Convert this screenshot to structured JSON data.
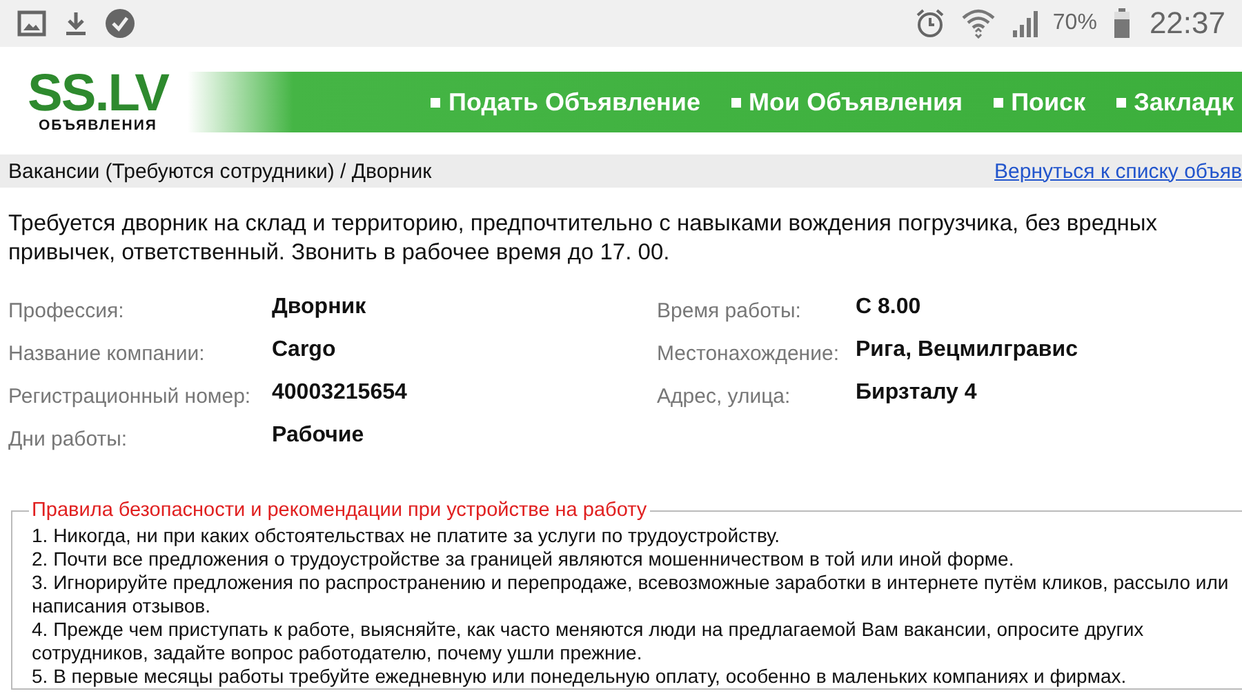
{
  "status_bar": {
    "battery": "70%",
    "time": "22:37"
  },
  "header": {
    "logo": "SS.LV",
    "logo_subtitle": "ОБЪЯВЛЕНИЯ",
    "menu": [
      {
        "label": "Подать Объявление"
      },
      {
        "label": "Мои Объявления"
      },
      {
        "label": "Поиск"
      },
      {
        "label": "Закладк"
      }
    ]
  },
  "breadcrumb": {
    "path": "Вакансии (Требуются сотрудники) / Дворник",
    "back_link": "Вернуться к списку объяв"
  },
  "description": "Требуется дворник на склад и территорию, предпочтительно с навыками вождения погрузчика, без вредных привычек, ответственный. Звонить в рабочее время до 17. 00.",
  "details": [
    [
      {
        "label": "Профессия:",
        "value": "Дворник"
      },
      {
        "label": "Название компании:",
        "value": "Cargo"
      },
      {
        "label": "Регистрационный номер:",
        "value": "40003215654"
      },
      {
        "label": "Дни работы:",
        "value": "Рабочие"
      }
    ],
    [
      {
        "label": "Время работы:",
        "value": "С 8.00"
      },
      {
        "label": "Местонахождение:",
        "value": "Рига, Вецмилгравис"
      },
      {
        "label": "Адрес, улица:",
        "value": "Бирзталу 4"
      }
    ]
  ],
  "safety": {
    "title": "Правила безопасности и рекомендации при устройстве на работу",
    "rules": [
      "1. Никогда, ни при каких обстоятельствах не платите за услуги по трудоустройству.",
      "2. Почти все предложения о трудоустройстве за границей являются мошенничеством в той или иной форме.",
      "3. Игнорируйте предложения по распространению и перепродаже, всевозможные заработки в интернете путём кликов, рассыло или написания отзывов.",
      "4. Прежде чем приступать к работе, выясняйте, как часто меняются люди на предлагаемой Вам вакансии, опросите других сотрудников, задайте вопрос работодателю, почему ушли прежние.",
      "5. В первые месяцы работы требуйте ежедневную или понедельную оплату, особенно в маленьких компаниях и фирмах."
    ]
  }
}
